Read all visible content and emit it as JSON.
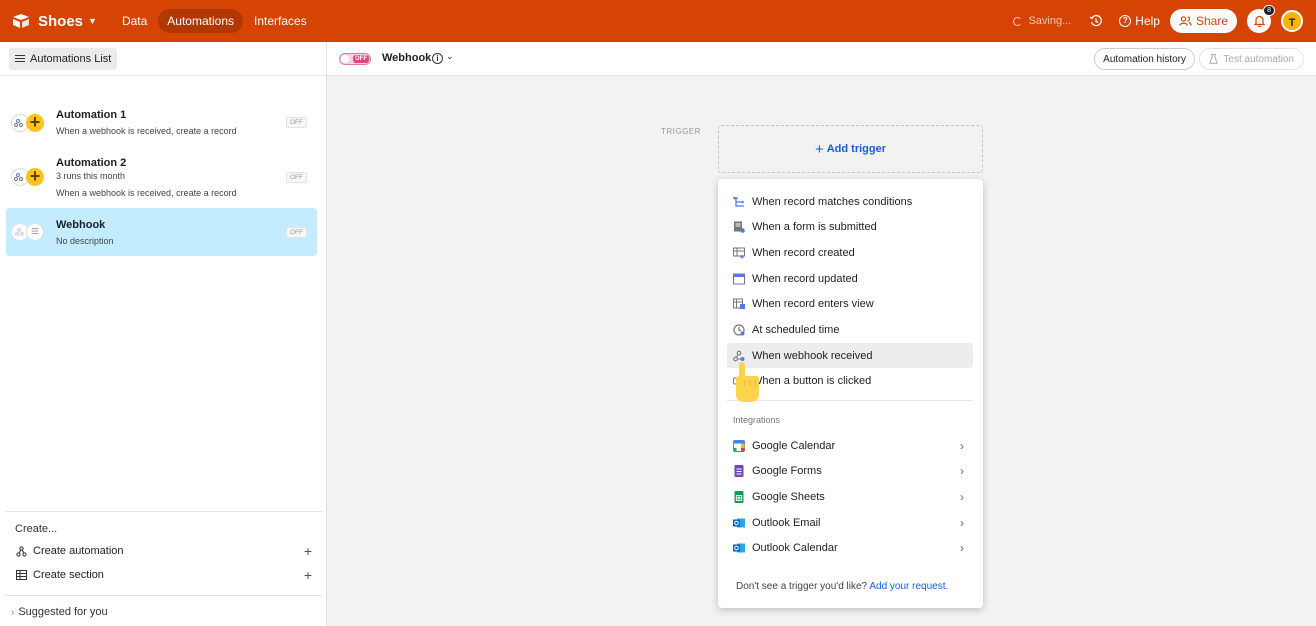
{
  "topbar": {
    "app_name": "Shoes",
    "nav": [
      "Data",
      "Automations",
      "Interfaces"
    ],
    "active_nav": "Automations",
    "saving": "Saving...",
    "help": "Help",
    "share": "Share",
    "notification_count": "8",
    "avatar_initial": "T",
    "bg_color": "#d54402"
  },
  "sidebar": {
    "list_button": "Automations List",
    "automations": [
      {
        "title": "Automation 1",
        "line1": "When a webhook is received, create a record",
        "line2": "",
        "status": "OFF"
      },
      {
        "title": "Automation 2",
        "line1": "3 runs this month",
        "line2": "When a webhook is received, create a record",
        "status": "OFF"
      },
      {
        "title": "Webhook",
        "line1": "No description",
        "line2": "",
        "status": "OFF",
        "selected": true
      }
    ],
    "create_label": "Create...",
    "create_automation": "Create automation",
    "create_section": "Create section",
    "suggested": "Suggested for you"
  },
  "header": {
    "toggle": "OFF",
    "name": "Webhook",
    "history": "Automation history",
    "test": "Test automation"
  },
  "canvas": {
    "trigger_label": "TRIGGER",
    "add_trigger": "Add trigger"
  },
  "dropdown": {
    "triggers": [
      "When record matches conditions",
      "When a form is submitted",
      "When record created",
      "When record updated",
      "When record enters view",
      "At scheduled time",
      "When webhook received",
      "When a button is clicked"
    ],
    "hovered": "When webhook received",
    "integrations_label": "Integrations",
    "integrations": [
      "Google Calendar",
      "Google Forms",
      "Google Sheets",
      "Outlook Email",
      "Outlook Calendar"
    ],
    "footer_text": "Don't see a trigger you'd like?",
    "footer_link": "Add your request."
  }
}
